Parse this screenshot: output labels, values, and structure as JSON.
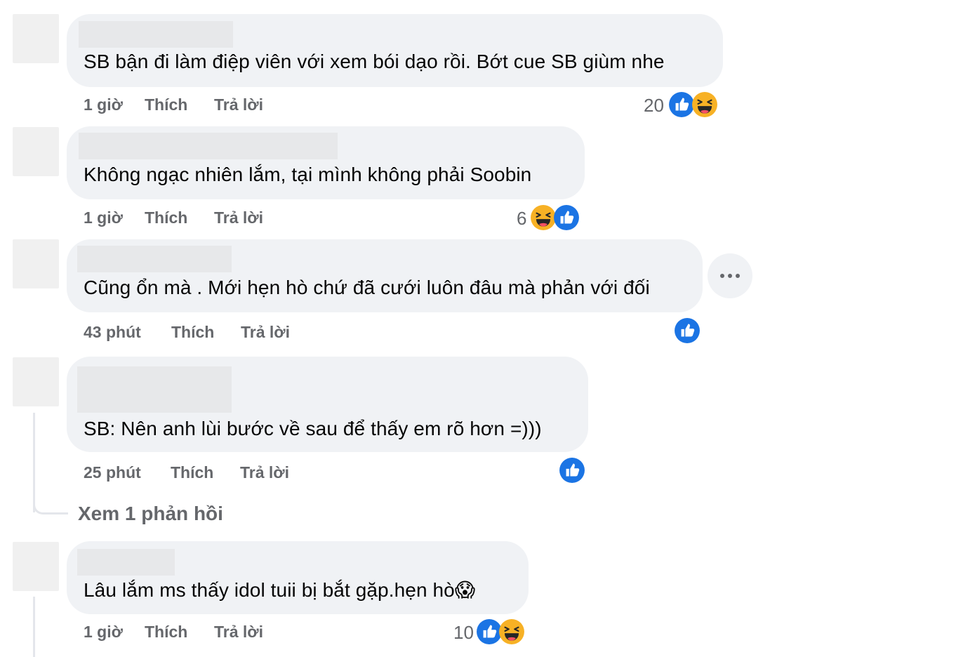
{
  "comments": [
    {
      "text": "SB bận đi làm điệp viên với xem bói dạo rồi. Bớt cue SB giùm nhe",
      "time": "1 giờ",
      "like_label": "Thích",
      "reply_label": "Trả lời",
      "reaction_count": "20",
      "reactions": [
        "like-icon",
        "haha-icon"
      ]
    },
    {
      "text": "Không ngạc nhiên lắm, tại mình không phải Soobin",
      "time": "1 giờ",
      "like_label": "Thích",
      "reply_label": "Trả lời",
      "reaction_count": "6",
      "reactions": [
        "haha-icon",
        "like-icon"
      ]
    },
    {
      "text": "Cũng ổn mà . Mới hẹn hò chứ đã cưới luôn đâu mà phản với đối",
      "time": "43 phút",
      "like_label": "Thích",
      "reply_label": "Trả lời",
      "reaction_count": "",
      "reactions": [
        "like-icon"
      ]
    },
    {
      "text": "SB: Nên anh lùi bước về sau để thấy em rõ hơn =)))",
      "time": "25 phút",
      "like_label": "Thích",
      "reply_label": "Trả lời",
      "reaction_count": "",
      "reactions": [
        "like-icon"
      ],
      "view_replies": "Xem 1 phản hồi"
    },
    {
      "text": "Lâu lắm ms thấy idol tuii bị bắt gặp.hẹn hò😱",
      "time": "1 giờ",
      "like_label": "Thích",
      "reply_label": "Trả lời",
      "reaction_count": "10",
      "reactions": [
        "like-icon",
        "haha-icon"
      ]
    }
  ],
  "colors": {
    "bubble": "#f0f2f5",
    "meta_text": "#65676b",
    "like_blue": "#1b74e4",
    "haha_yellow": "#f7b125"
  }
}
